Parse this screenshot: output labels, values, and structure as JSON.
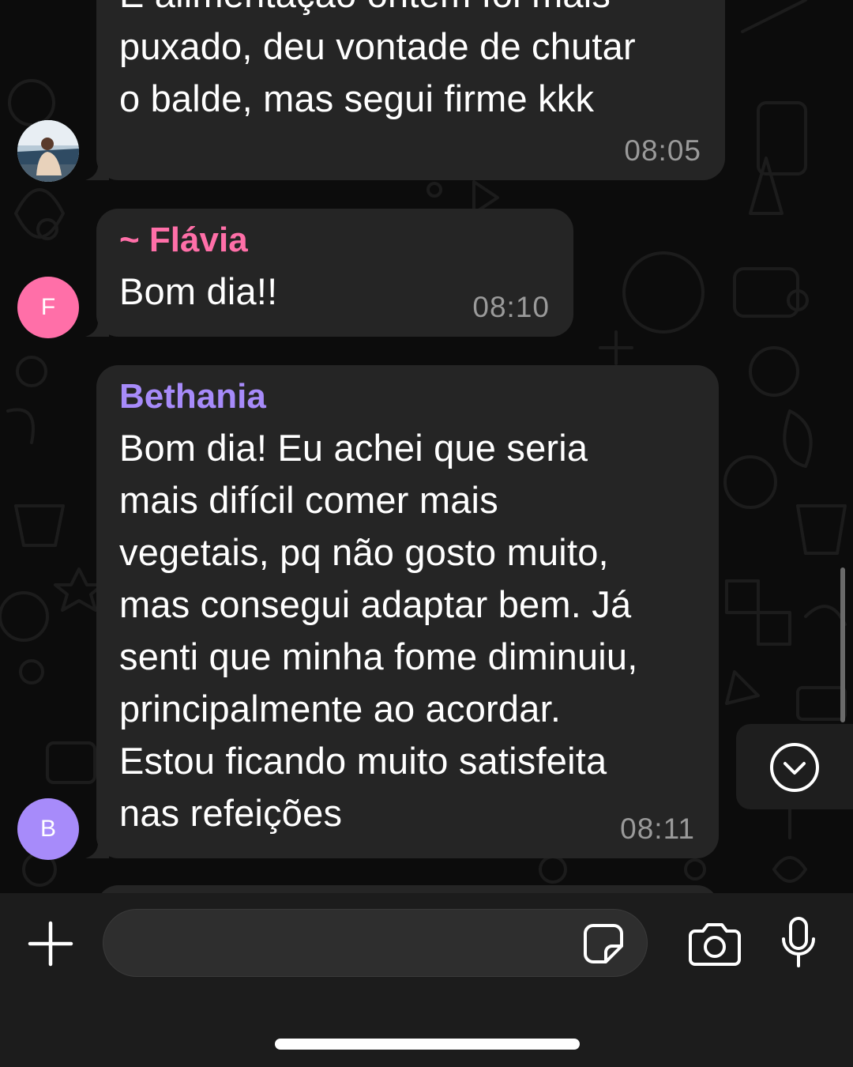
{
  "messages": [
    {
      "sender": "",
      "text": "E alimentação ontem foi mais\npuxado, deu vontade de chutar\no balde, mas segui firme kkk",
      "time": "08:05",
      "avatar": "profile-photo"
    },
    {
      "sender": "~ Flávia",
      "sender_color": "#ff6fa8",
      "text": "Bom dia!!",
      "time": "08:10",
      "avatar_initial": "F",
      "avatar_color": "#ff6fa8"
    },
    {
      "sender": "Bethania",
      "sender_color": "#a78bfa",
      "text": "Bom dia! Eu achei que seria\nmais difícil comer mais\nvegetais, pq não gosto muito,\nmas consegui adaptar bem. Já\nsenti que minha fome diminuiu,\nprincipalmente ao acordar.\nEstou ficando muito satisfeita\nnas refeições",
      "time": "08:11",
      "avatar_initial": "B",
      "avatar_color": "#a78bfa"
    }
  ],
  "composer": {
    "placeholder": "",
    "icons": [
      "plus-icon",
      "sticker-icon",
      "camera-icon",
      "microphone-icon"
    ]
  },
  "scroll_button_icon": "chevron-down-icon",
  "colors": {
    "bubble": "#252525",
    "background": "#0c0c0c",
    "timestamp": "#9a9a9a"
  }
}
